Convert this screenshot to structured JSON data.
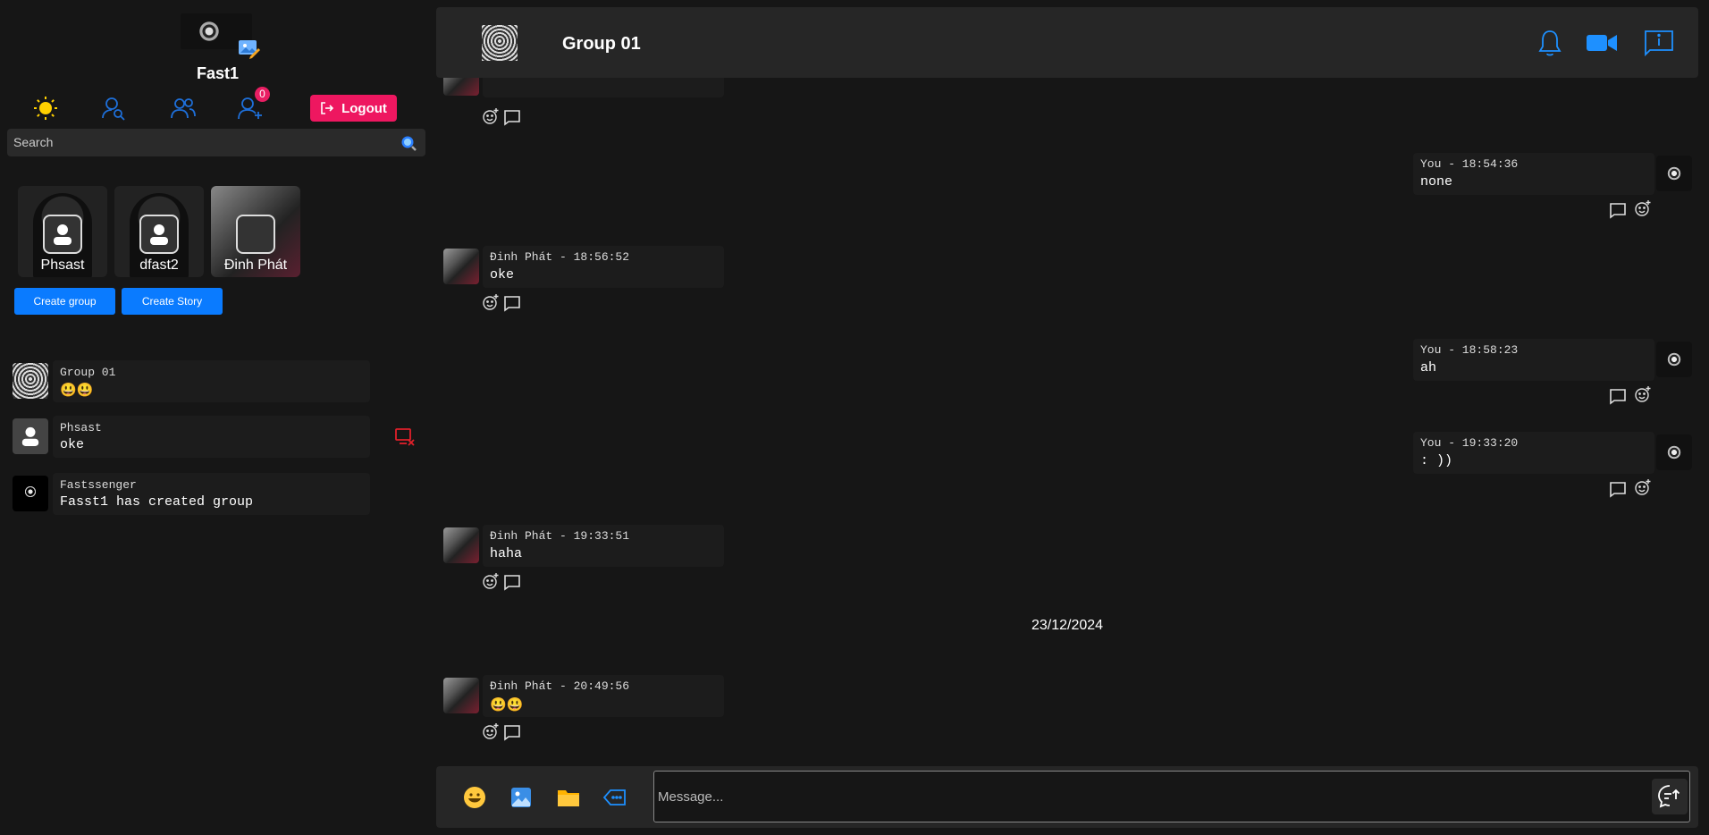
{
  "profile": {
    "name": "Fast1"
  },
  "nav": {
    "friend_requests_count": "0",
    "logout_label": "Logout"
  },
  "search": {
    "placeholder": "Search"
  },
  "stories": [
    {
      "name": "Phsast"
    },
    {
      "name": "dfast2"
    },
    {
      "name": "Đinh Phát"
    }
  ],
  "actions": {
    "create_group": "Create group",
    "create_story": "Create Story"
  },
  "conversations": [
    {
      "name": "Group 01",
      "last": "😃😃"
    },
    {
      "name": "Phsast",
      "last": "oke"
    },
    {
      "name": "Fastssenger",
      "last": "Fasst1 has created group"
    }
  ],
  "chat": {
    "title": "Group 01",
    "messages": [
      {
        "meta": "",
        "text": "??"
      },
      {
        "meta": "You - 18:54:36",
        "text": "none"
      },
      {
        "meta": "Đinh Phát - 18:56:52",
        "text": "oke"
      },
      {
        "meta": "You - 18:58:23",
        "text": "ah"
      },
      {
        "meta": "You - 19:33:20",
        "text": ": ))"
      },
      {
        "meta": "Đinh Phát - 19:33:51",
        "text": "haha"
      },
      {
        "meta": "Đinh Phát - 20:49:56",
        "text": "😃😃"
      }
    ],
    "date_divider": "23/12/2024"
  },
  "composer": {
    "placeholder": "Message..."
  },
  "colors": {
    "accent_blue": "#0a7bff",
    "logout_pink": "#ee1760",
    "icon_blue": "#1e90ff",
    "icon_yellow": "#ffd000"
  }
}
